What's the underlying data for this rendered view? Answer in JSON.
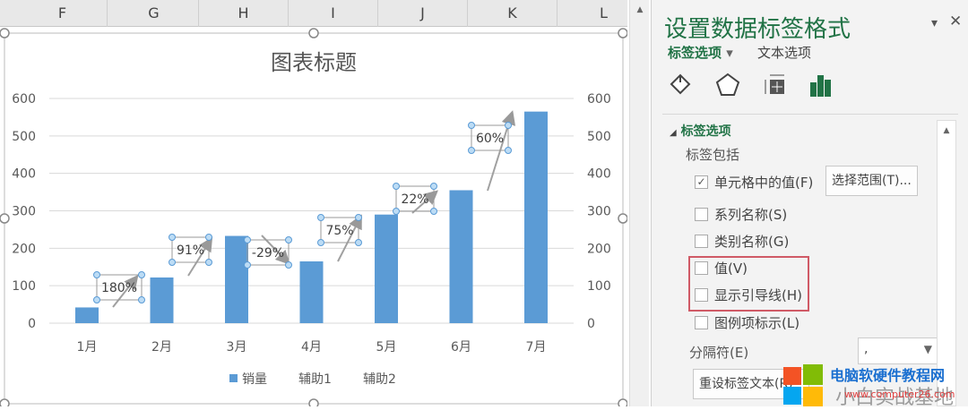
{
  "columns": [
    "F",
    "G",
    "H",
    "I",
    "J",
    "K",
    "L"
  ],
  "chart_data": {
    "type": "bar",
    "title": "图表标题",
    "categories": [
      "1月",
      "2月",
      "3月",
      "4月",
      "5月",
      "6月",
      "7月"
    ],
    "series": [
      {
        "name": "销量",
        "values": [
          42,
          122,
          233,
          165,
          290,
          355,
          565
        ]
      }
    ],
    "growth_labels": [
      "180%",
      "91%",
      "-29%",
      "75%",
      "22%",
      "60%"
    ],
    "ylim": [
      0,
      600
    ],
    "yticks": [
      0,
      100,
      200,
      300,
      400,
      500,
      600
    ],
    "y2ticks": [
      0,
      100,
      200,
      300,
      400,
      500,
      600
    ],
    "grid": true,
    "legend": {
      "placement": "bottom",
      "entries": [
        "销量",
        "辅助1",
        "辅助2"
      ]
    },
    "bar_color": "#5b9bd5"
  },
  "panel": {
    "title": "设置数据标签格式",
    "tab_label_options": "标签选项",
    "tab_text_options": "文本选项",
    "icons": [
      "fill-icon",
      "pentagon-effects-icon",
      "size-properties-icon",
      "bar-chart-options-icon"
    ],
    "section": "标签选项",
    "subheading": "标签包括",
    "checkboxes": [
      {
        "label": "单元格中的值(F)",
        "checked": true
      },
      {
        "label": "系列名称(S)",
        "checked": false
      },
      {
        "label": "类别名称(G)",
        "checked": false
      },
      {
        "label": "值(V)",
        "checked": false
      },
      {
        "label": "显示引导线(H)",
        "checked": false
      },
      {
        "label": "图例项标示(L)",
        "checked": false
      }
    ],
    "select_range": "选择范围(T)...",
    "separator_label": "分隔符(E)",
    "separator_value": ",",
    "reset_button": "重设标签文本(R)",
    "accent": "#217346"
  },
  "watermark": {
    "line1": "电脑软硬件教程网",
    "line2": "小白实战基地",
    "url": "www.computer26.com"
  }
}
